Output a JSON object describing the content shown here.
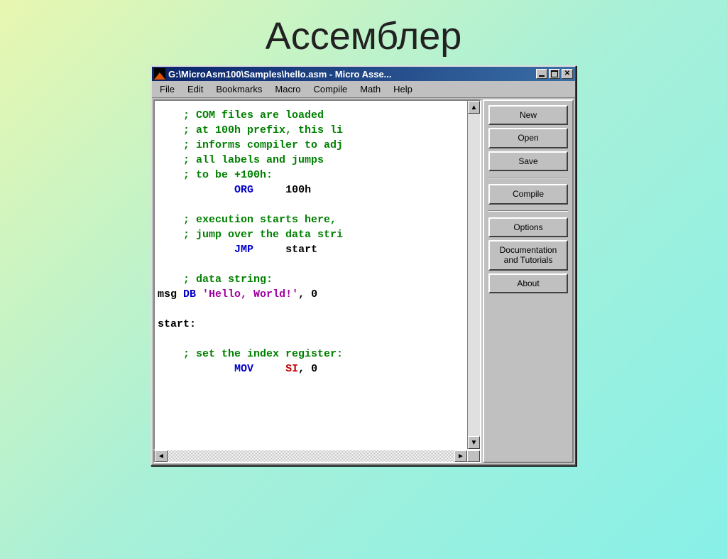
{
  "slide": {
    "title": "Ассемблер"
  },
  "window": {
    "title": "G:\\MicroAsm100\\Samples\\hello.asm - Micro Asse...",
    "menu": [
      "File",
      "Edit",
      "Bookmarks",
      "Macro",
      "Compile",
      "Math",
      "Help"
    ],
    "code_lines": [
      {
        "indent": 0,
        "segments": [
          {
            "cls": "tok-comment",
            "text": "; COM files are loaded"
          }
        ]
      },
      {
        "indent": 0,
        "segments": [
          {
            "cls": "tok-comment",
            "text": "; at 100h prefix, this li"
          }
        ]
      },
      {
        "indent": 0,
        "segments": [
          {
            "cls": "tok-comment",
            "text": "; informs compiler to adj"
          }
        ]
      },
      {
        "indent": 0,
        "segments": [
          {
            "cls": "tok-comment",
            "text": "; all labels and jumps"
          }
        ]
      },
      {
        "indent": 0,
        "segments": [
          {
            "cls": "tok-comment",
            "text": "; to be +100h:"
          }
        ]
      },
      {
        "indent": 8,
        "segments": [
          {
            "cls": "tok-keyword",
            "text": "ORG"
          },
          {
            "cls": "",
            "text": "     "
          },
          {
            "cls": "tok-number",
            "text": "100h"
          }
        ]
      },
      {
        "indent": 0,
        "segments": [
          {
            "cls": "",
            "text": ""
          }
        ]
      },
      {
        "indent": 0,
        "segments": [
          {
            "cls": "tok-comment",
            "text": "; execution starts here,"
          }
        ]
      },
      {
        "indent": 0,
        "segments": [
          {
            "cls": "tok-comment",
            "text": "; jump over the data stri"
          }
        ]
      },
      {
        "indent": 8,
        "segments": [
          {
            "cls": "tok-keyword",
            "text": "JMP"
          },
          {
            "cls": "",
            "text": "     "
          },
          {
            "cls": "tok-label",
            "text": "start"
          }
        ]
      },
      {
        "indent": 0,
        "segments": [
          {
            "cls": "",
            "text": ""
          }
        ]
      },
      {
        "indent": 0,
        "segments": [
          {
            "cls": "tok-comment",
            "text": "; data string:"
          }
        ]
      },
      {
        "indent": -4,
        "segments": [
          {
            "cls": "tok-label",
            "text": "msg "
          },
          {
            "cls": "tok-keyword",
            "text": "DB"
          },
          {
            "cls": "",
            "text": " "
          },
          {
            "cls": "tok-string",
            "text": "'Hello, World!'"
          },
          {
            "cls": "tok-label",
            "text": ", "
          },
          {
            "cls": "tok-number",
            "text": "0"
          }
        ]
      },
      {
        "indent": 0,
        "segments": [
          {
            "cls": "",
            "text": ""
          }
        ]
      },
      {
        "indent": -4,
        "segments": [
          {
            "cls": "tok-label",
            "text": "start:"
          }
        ]
      },
      {
        "indent": 0,
        "segments": [
          {
            "cls": "",
            "text": ""
          }
        ]
      },
      {
        "indent": 0,
        "segments": [
          {
            "cls": "tok-comment",
            "text": "; set the index register:"
          }
        ]
      },
      {
        "indent": 8,
        "segments": [
          {
            "cls": "tok-keyword",
            "text": "MOV"
          },
          {
            "cls": "",
            "text": "     "
          },
          {
            "cls": "tok-reg",
            "text": "SI"
          },
          {
            "cls": "tok-label",
            "text": ", "
          },
          {
            "cls": "tok-number",
            "text": "0"
          }
        ]
      }
    ],
    "sidebar": {
      "new": "New",
      "open": "Open",
      "save": "Save",
      "compile": "Compile",
      "options": "Options",
      "docs": "Documentation\nand Tutorials",
      "about": "About"
    }
  }
}
